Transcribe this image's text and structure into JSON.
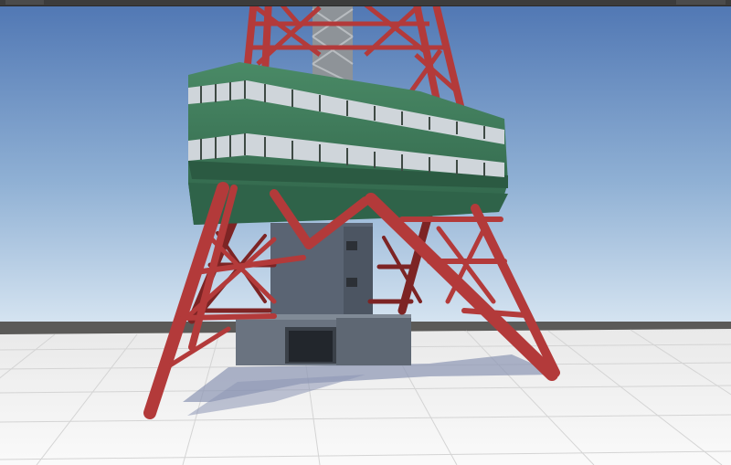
{
  "scene": {
    "sky_top_color": "#4f76b3",
    "sky_horizon_color": "#d8e6f2",
    "ground_color": "#f4f4f4",
    "grid_line_color": "#d9d9d9",
    "horizon_band_color": "#5b5a58",
    "lattice_color": "#b33a3a",
    "lattice_shadow_color": "#7d2424",
    "deck_color": "#3e7d5b",
    "deck_dark_color": "#2b5a42",
    "window_strip_color": "#cfd5da",
    "core_color": "#5a6473",
    "base_block_color": "#6a7380",
    "shadow_color": "#8c96b4",
    "inner_mast_color": "#8e9398"
  },
  "editor": {
    "tabs": [
      "scene-tab-1",
      "scene-tab-2"
    ]
  }
}
